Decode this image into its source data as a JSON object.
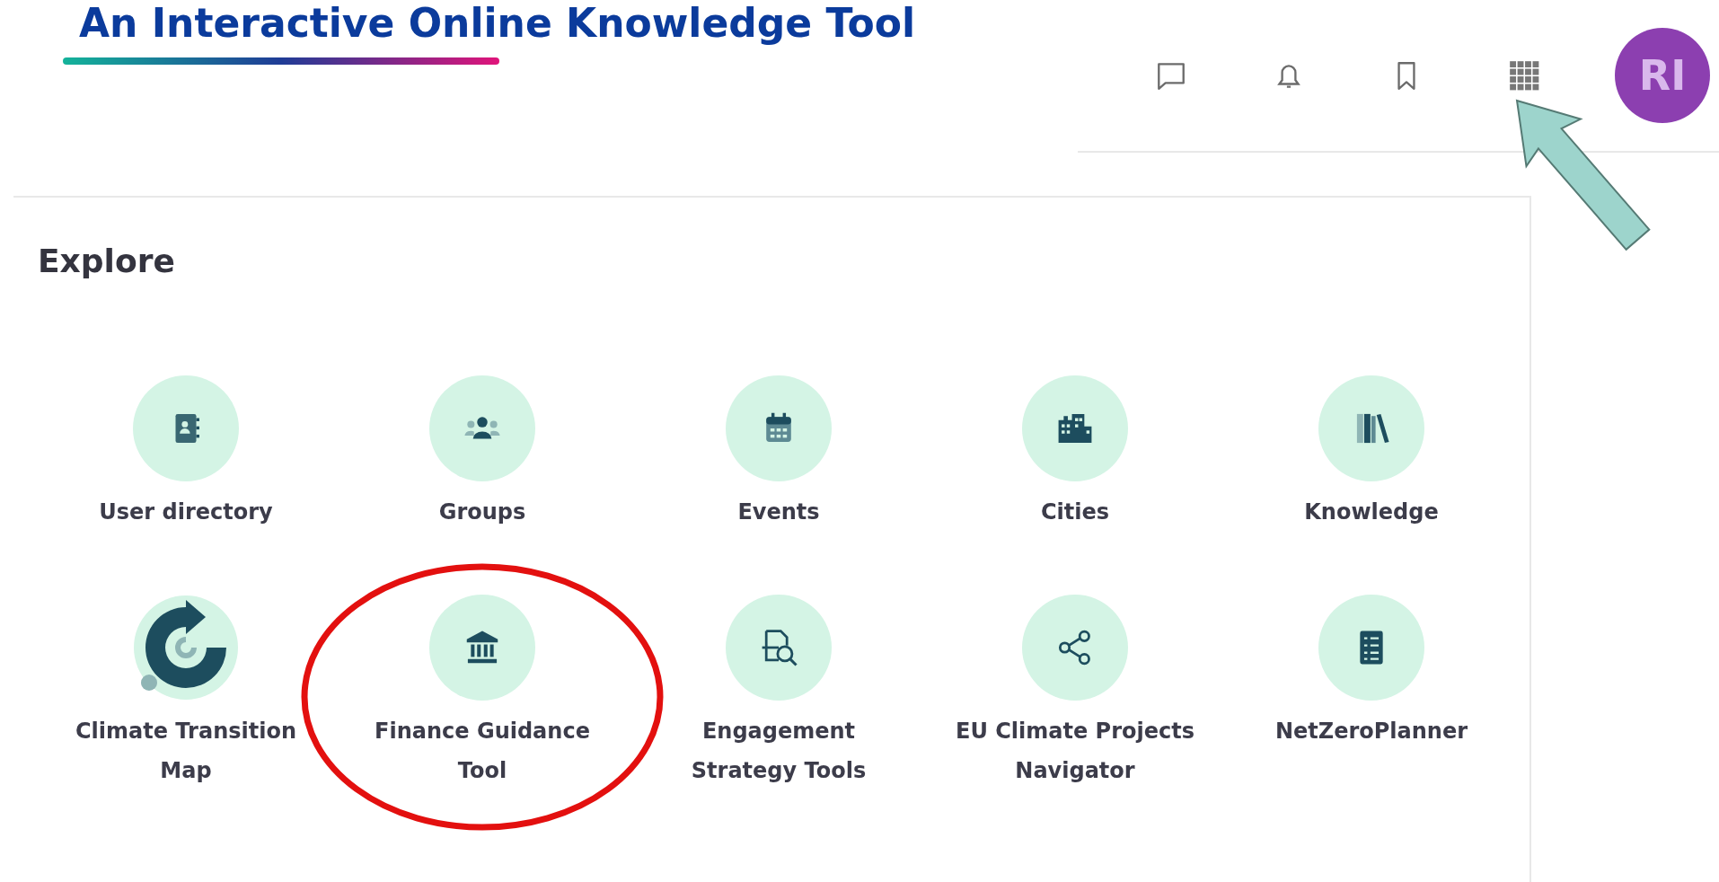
{
  "slide_title": "An Interactive Online Knowledge Tool",
  "header": {
    "buttons": [
      {
        "kind": "messages",
        "pointed": false
      },
      {
        "kind": "notifications",
        "pointed": false
      },
      {
        "kind": "bookmarks",
        "pointed": false
      },
      {
        "kind": "apps",
        "pointed": true
      }
    ],
    "avatar": {
      "initials": "RI"
    }
  },
  "explore": {
    "title": "Explore",
    "items": [
      {
        "label": "User directory",
        "highlighted": false
      },
      {
        "label": "Groups",
        "highlighted": false
      },
      {
        "label": "Events",
        "highlighted": false
      },
      {
        "label": "Cities",
        "highlighted": false
      },
      {
        "label": "Knowledge",
        "highlighted": false
      },
      {
        "label": "Climate Transition Map",
        "highlighted": false
      },
      {
        "label": "Finance Guidance Tool",
        "highlighted": true
      },
      {
        "label": "Engagement Strategy Tools",
        "highlighted": false
      },
      {
        "label": "EU Climate Projects Navigator",
        "highlighted": false
      },
      {
        "label": "NetZeroPlanner",
        "highlighted": false
      }
    ]
  }
}
